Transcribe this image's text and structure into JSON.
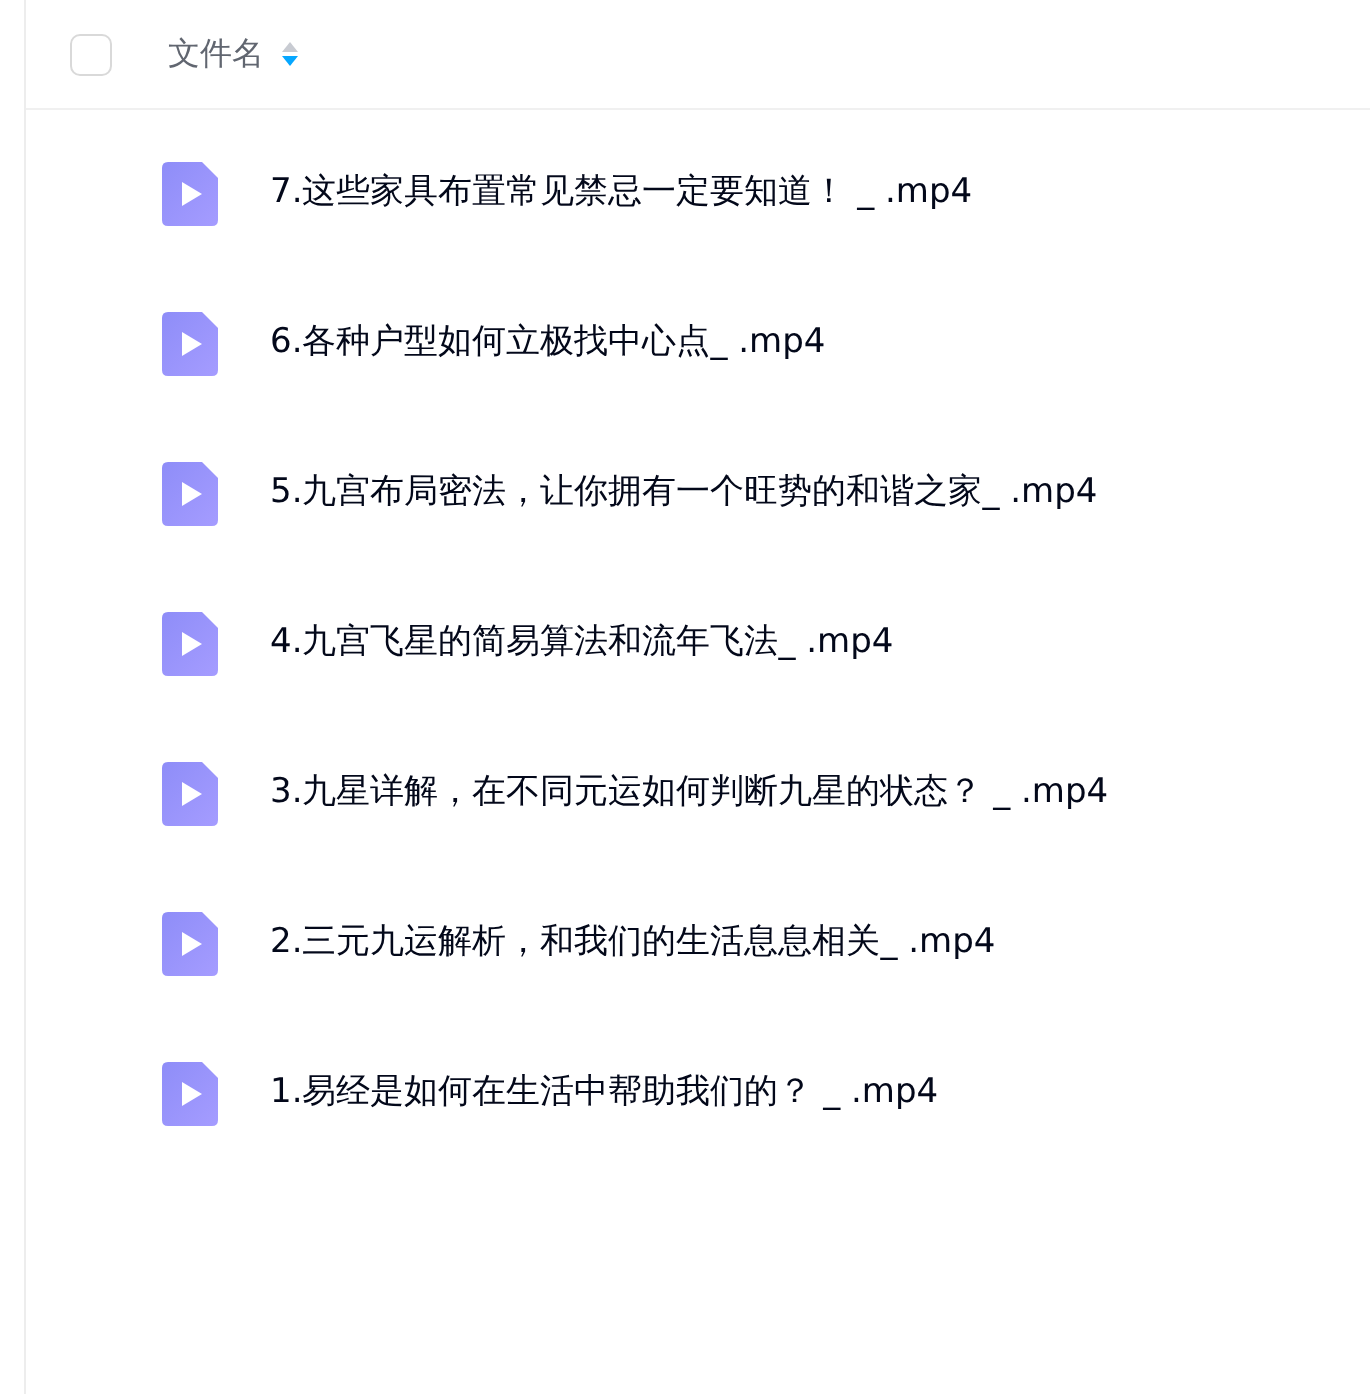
{
  "header": {
    "select_all": {
      "checked": false
    },
    "column_label": "文件名",
    "sort_descending": true
  },
  "files": [
    {
      "name": "7.这些家具布置常见禁忌一定要知道！ _ .mp4"
    },
    {
      "name": "6.各种户型如何立极找中心点_ .mp4"
    },
    {
      "name": "5.九宫布局密法，让你拥有一个旺势的和谐之家_ .mp4"
    },
    {
      "name": "4.九宫飞星的简易算法和流年飞法_ .mp4"
    },
    {
      "name": "3.九星详解，在不同元运如何判断九星的状态？ _ .mp4"
    },
    {
      "name": "2.三元九运解析，和我们的生活息息相关_ .mp4"
    },
    {
      "name": "1.易经是如何在生活中帮助我们的？ _ .mp4"
    }
  ]
}
